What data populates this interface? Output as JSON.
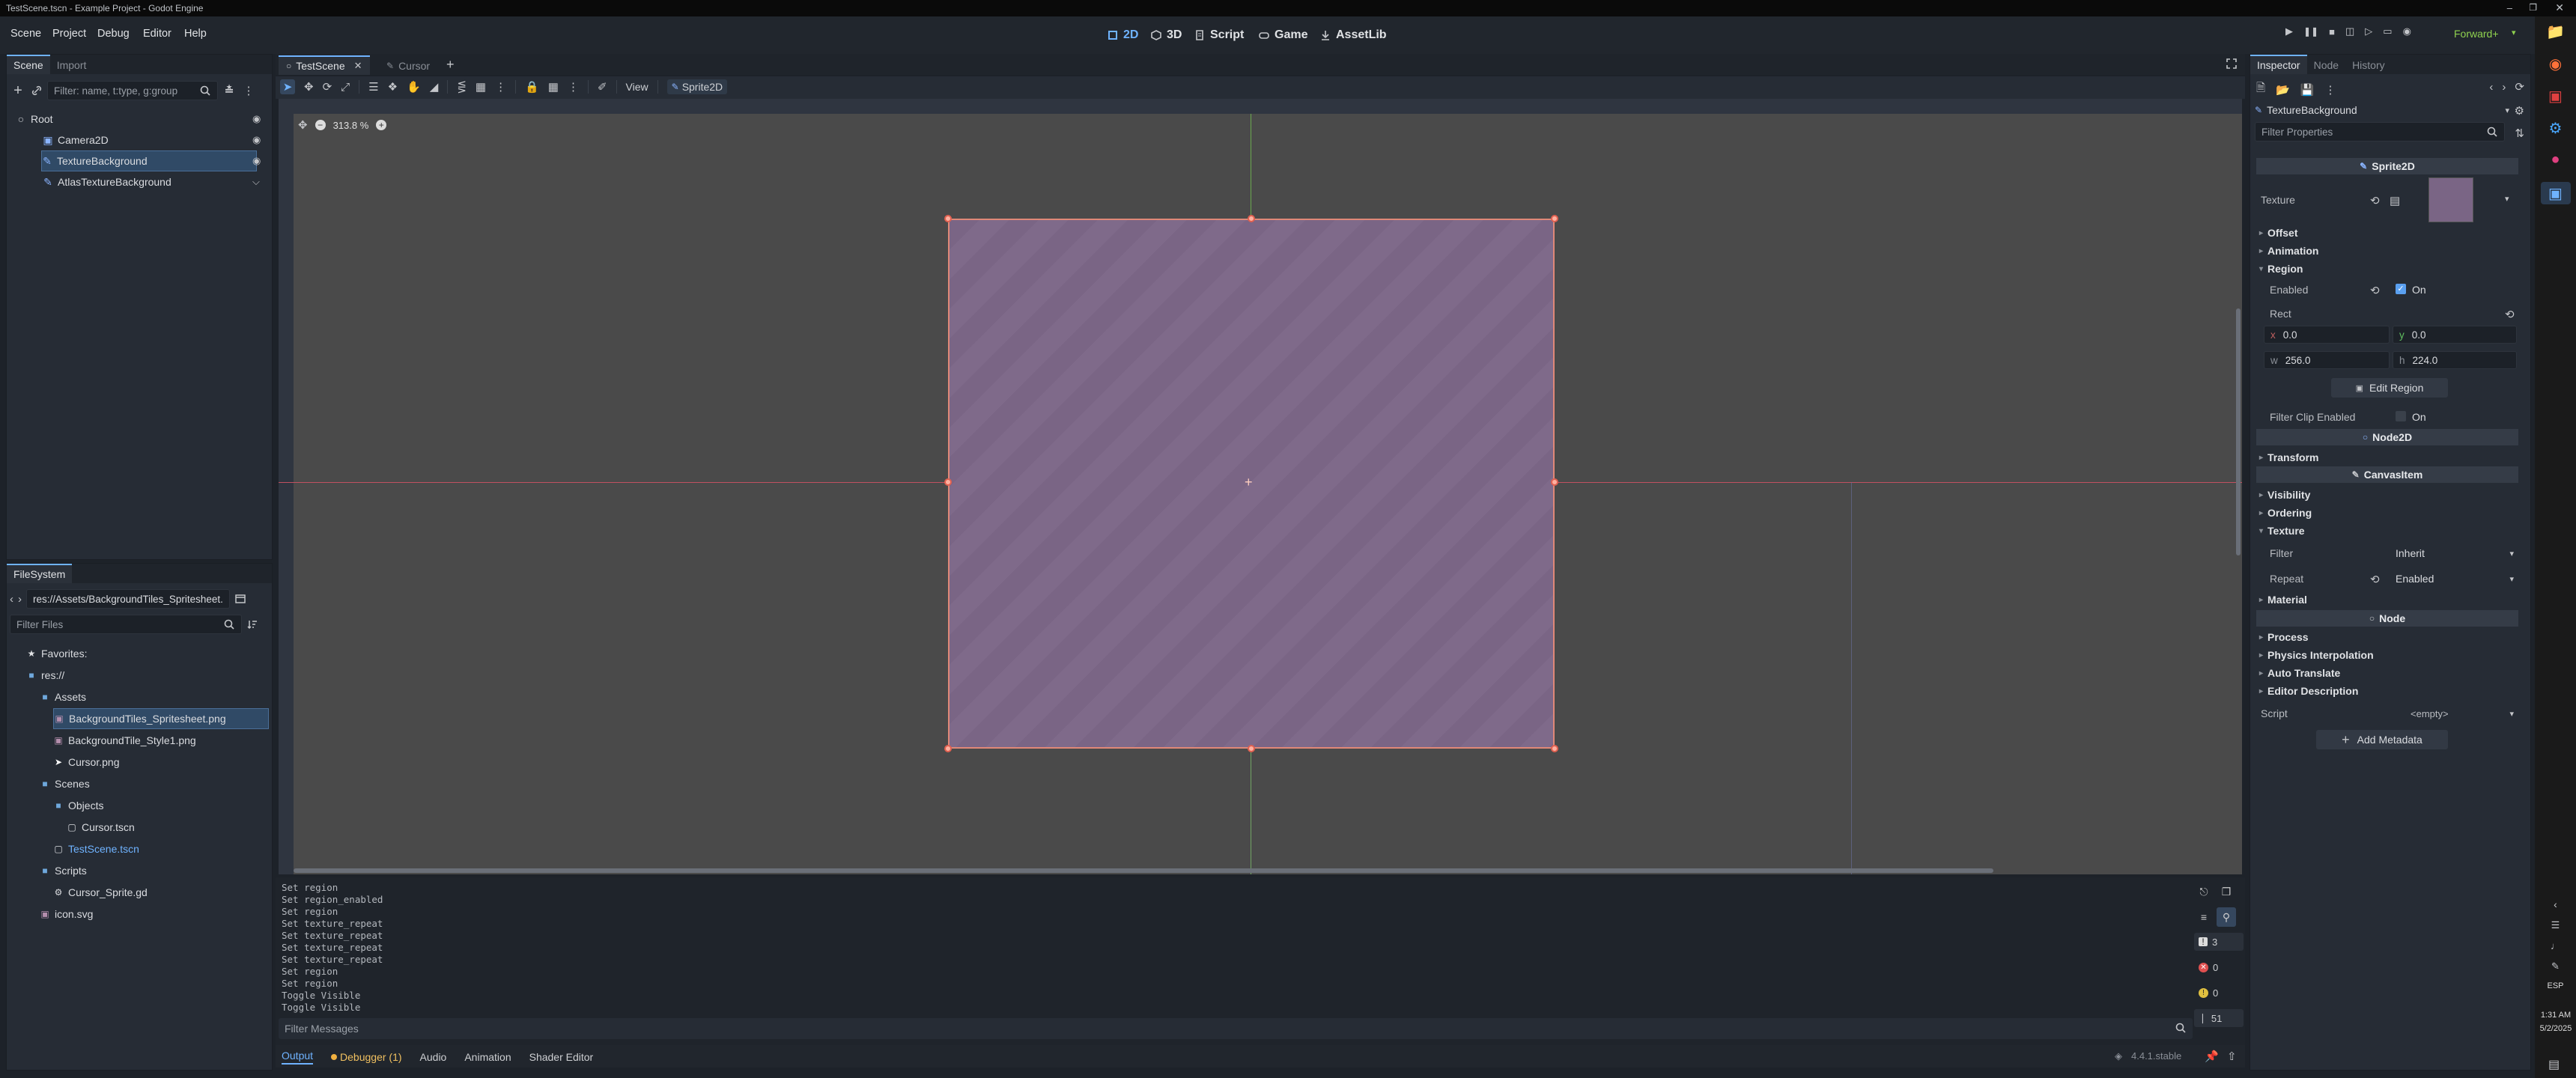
{
  "window": {
    "title": "TestScene.tscn - Example Project - Godot Engine"
  },
  "menu": [
    "Scene",
    "Project",
    "Debug",
    "Editor",
    "Help"
  ],
  "workspaces": [
    {
      "label": "2D",
      "icon": "2d-icon",
      "active": true
    },
    {
      "label": "3D",
      "icon": "3d-icon",
      "active": false
    },
    {
      "label": "Script",
      "icon": "script-icon",
      "active": false
    },
    {
      "label": "Game",
      "icon": "game-icon",
      "active": false
    },
    {
      "label": "AssetLib",
      "icon": "assetlib-icon",
      "active": false
    }
  ],
  "renderer": "Forward+",
  "scene_dock": {
    "tabs": [
      "Scene",
      "Import"
    ],
    "filter_placeholder": "Filter: name, t:type, g:group",
    "nodes": [
      {
        "label": "Root",
        "icon": "node-icon",
        "indent": 0
      },
      {
        "label": "Camera2D",
        "icon": "camera-icon",
        "indent": 1
      },
      {
        "label": "TextureBackground",
        "icon": "sprite-icon",
        "indent": 1,
        "selected": true
      },
      {
        "label": "AtlasTextureBackground",
        "icon": "sprite-icon",
        "indent": 1
      }
    ]
  },
  "filesystem": {
    "title": "FileSystem",
    "path": "res://Assets/BackgroundTiles_Spritesheet.png",
    "filter_placeholder": "Filter Files",
    "items": [
      {
        "label": "Favorites:",
        "icon": "star-icon",
        "indent": 0
      },
      {
        "label": "res://",
        "icon": "folder-icon",
        "indent": 0
      },
      {
        "label": "Assets",
        "icon": "folder-icon",
        "indent": 1
      },
      {
        "label": "BackgroundTiles_Spritesheet.png",
        "icon": "image-icon",
        "indent": 2,
        "selected": true
      },
      {
        "label": "BackgroundTile_Style1.png",
        "icon": "image-icon",
        "indent": 2
      },
      {
        "label": "Cursor.png",
        "icon": "cursor-icon",
        "indent": 2
      },
      {
        "label": "Scenes",
        "icon": "folder-icon",
        "indent": 1
      },
      {
        "label": "Objects",
        "icon": "folder-icon",
        "indent": 2
      },
      {
        "label": "Cursor.tscn",
        "icon": "scene-icon",
        "indent": 3
      },
      {
        "label": "TestScene.tscn",
        "icon": "scene-icon",
        "indent": 2,
        "highlight": true
      },
      {
        "label": "Scripts",
        "icon": "folder-icon",
        "indent": 1
      },
      {
        "label": "Cursor_Sprite.gd",
        "icon": "gear-icon",
        "indent": 2
      },
      {
        "label": "icon.svg",
        "icon": "image-icon",
        "indent": 1
      }
    ]
  },
  "editor_tabs": [
    {
      "label": "TestScene",
      "active": true
    },
    {
      "label": "Cursor",
      "active": false
    }
  ],
  "toolbar": {
    "view_label": "View",
    "node_label": "Sprite2D"
  },
  "viewport": {
    "zoom": "313.8 %"
  },
  "output": {
    "lines": [
      "Set region",
      "Set region_enabled",
      "Set region",
      "Set texture_repeat",
      "Set texture_repeat",
      "Set texture_repeat",
      "Set texture_repeat",
      "Set region",
      "Set region",
      "Toggle Visible",
      "Toggle Visible"
    ],
    "filter_placeholder": "Filter Messages",
    "counts": [
      "3",
      "0",
      "0",
      "51"
    ]
  },
  "bottom_tabs": [
    "Output",
    "Debugger (1)",
    "Audio",
    "Animation",
    "Shader Editor"
  ],
  "version": "4.4.1.stable",
  "inspector": {
    "tabs": [
      "Inspector",
      "Node",
      "History"
    ],
    "object": "TextureBackground",
    "filter_placeholder": "Filter Properties",
    "class_sprite": "Sprite2D",
    "texture_label": "Texture",
    "sections": {
      "offset": "Offset",
      "animation": "Animation",
      "region": "Region",
      "transform": "Transform",
      "visibility": "Visibility",
      "ordering": "Ordering",
      "texture": "Texture",
      "material": "Material",
      "process": "Process",
      "physics": "Physics Interpolation",
      "auto_translate": "Auto Translate",
      "editor_desc": "Editor Description"
    },
    "region": {
      "enabled_label": "Enabled",
      "enabled_value": "On",
      "rect_label": "Rect",
      "x_label": "x",
      "x": "0.0",
      "y_label": "y",
      "y": "0.0",
      "w_label": "w",
      "w": "256.0",
      "h_label": "h",
      "h": "224.0",
      "edit_button": "Edit Region",
      "filter_clip_label": "Filter Clip Enabled",
      "filter_clip_value": "On"
    },
    "class_node2d": "Node2D",
    "class_canvasitem": "CanvasItem",
    "texture_group": {
      "filter_label": "Filter",
      "filter_value": "Inherit",
      "repeat_label": "Repeat",
      "repeat_value": "Enabled"
    },
    "class_node": "Node",
    "script_label": "Script",
    "script_value": "<empty>",
    "add_metadata": "Add Metadata"
  },
  "clock": {
    "time": "1:31 AM",
    "date": "5/2/2025",
    "lang": "ESP"
  },
  "colors": {
    "accent": "#6fb3ff",
    "sprite_fill": "#7a6585",
    "selection": "#304a66"
  }
}
